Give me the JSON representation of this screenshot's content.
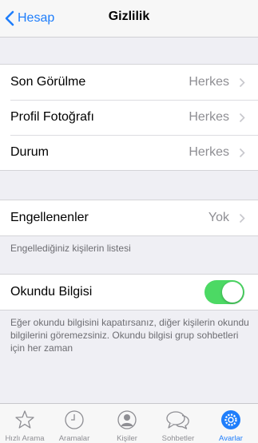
{
  "nav": {
    "back_label": "Hesap",
    "title": "Gizlilik"
  },
  "group1": [
    {
      "label": "Son Görülme",
      "value": "Herkes"
    },
    {
      "label": "Profil Fotoğrafı",
      "value": "Herkes"
    },
    {
      "label": "Durum",
      "value": "Herkes"
    }
  ],
  "blocked": {
    "label": "Engellenenler",
    "value": "Yok",
    "footnote": "Engellediğiniz kişilerin listesi"
  },
  "read_receipts": {
    "label": "Okundu Bilgisi",
    "enabled": true,
    "footnote": "Eğer okundu bilgisini kapatırsanız, diğer kişilerin okundu bilgilerini göremezsiniz. Okundu bilgisi grup sohbetleri için her zaman"
  },
  "tabs": [
    {
      "label": "Hızlı Arama",
      "icon": "star-icon",
      "active": false
    },
    {
      "label": "Aramalar",
      "icon": "clock-icon",
      "active": false
    },
    {
      "label": "Kişiler",
      "icon": "person-icon",
      "active": false
    },
    {
      "label": "Sohbetler",
      "icon": "chat-bubbles-icon",
      "active": false
    },
    {
      "label": "Avarlar",
      "icon": "gear-icon",
      "active": true
    }
  ],
  "colors": {
    "accent": "#1f7efb",
    "toggle_on": "#4cd964",
    "secondary_text": "#8e8e93"
  }
}
